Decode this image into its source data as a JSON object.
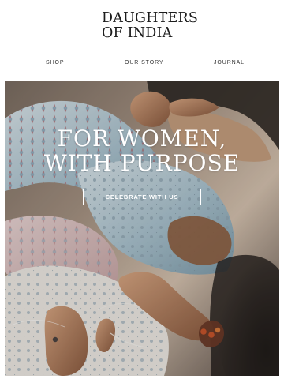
{
  "brand": {
    "logo_text": "DAUGHTERS\nOF INDIA"
  },
  "nav": {
    "items": [
      {
        "label": "SHOP"
      },
      {
        "label": "OUR STORY"
      },
      {
        "label": "JOURNAL"
      }
    ]
  },
  "hero": {
    "headline": "FOR WOMEN,\nWITH PURPOSE",
    "cta_label": "CELEBRATE WITH US",
    "photo_icon": "textile-handwork-image"
  },
  "colors": {
    "text": "#1c1c1c",
    "background": "#ffffff",
    "hero_overlay_text": "#ffffff"
  }
}
